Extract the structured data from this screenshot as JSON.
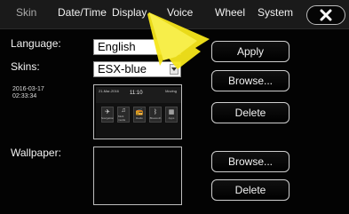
{
  "tabs": [
    {
      "label": "Skin"
    },
    {
      "label": "Date/Time"
    },
    {
      "label": "Display"
    },
    {
      "label": "Voice"
    },
    {
      "label": "Wheel"
    },
    {
      "label": "System"
    }
  ],
  "form": {
    "language_label": "Language:",
    "language_value": "English",
    "skins_label": "Skins:",
    "skins_value": "ESX-blue",
    "timestamp_date": "2016-03-17",
    "timestamp_time": "02:33:34",
    "wallpaper_label": "Wallpaper:"
  },
  "buttons": {
    "apply": "Apply",
    "browse_skin": "Browse...",
    "delete_skin": "Delete",
    "browse_wallpaper": "Browse...",
    "delete_wallpaper": "Delete"
  },
  "preview": {
    "date": "21-Mar-2016",
    "time": "11:10",
    "status": "Moving",
    "tiles": [
      {
        "icon": "navigation-icon",
        "label": "Navigation"
      },
      {
        "icon": "multimedia-icon",
        "label": "Multi media"
      },
      {
        "icon": "radio-icon",
        "label": "Radio"
      },
      {
        "icon": "bluetooth-icon",
        "label": "Bluetooth"
      },
      {
        "icon": "apps-icon",
        "label": "Apps"
      }
    ]
  },
  "colors": {
    "annotation_arrow": "#f5e61a",
    "background": "#030303"
  }
}
